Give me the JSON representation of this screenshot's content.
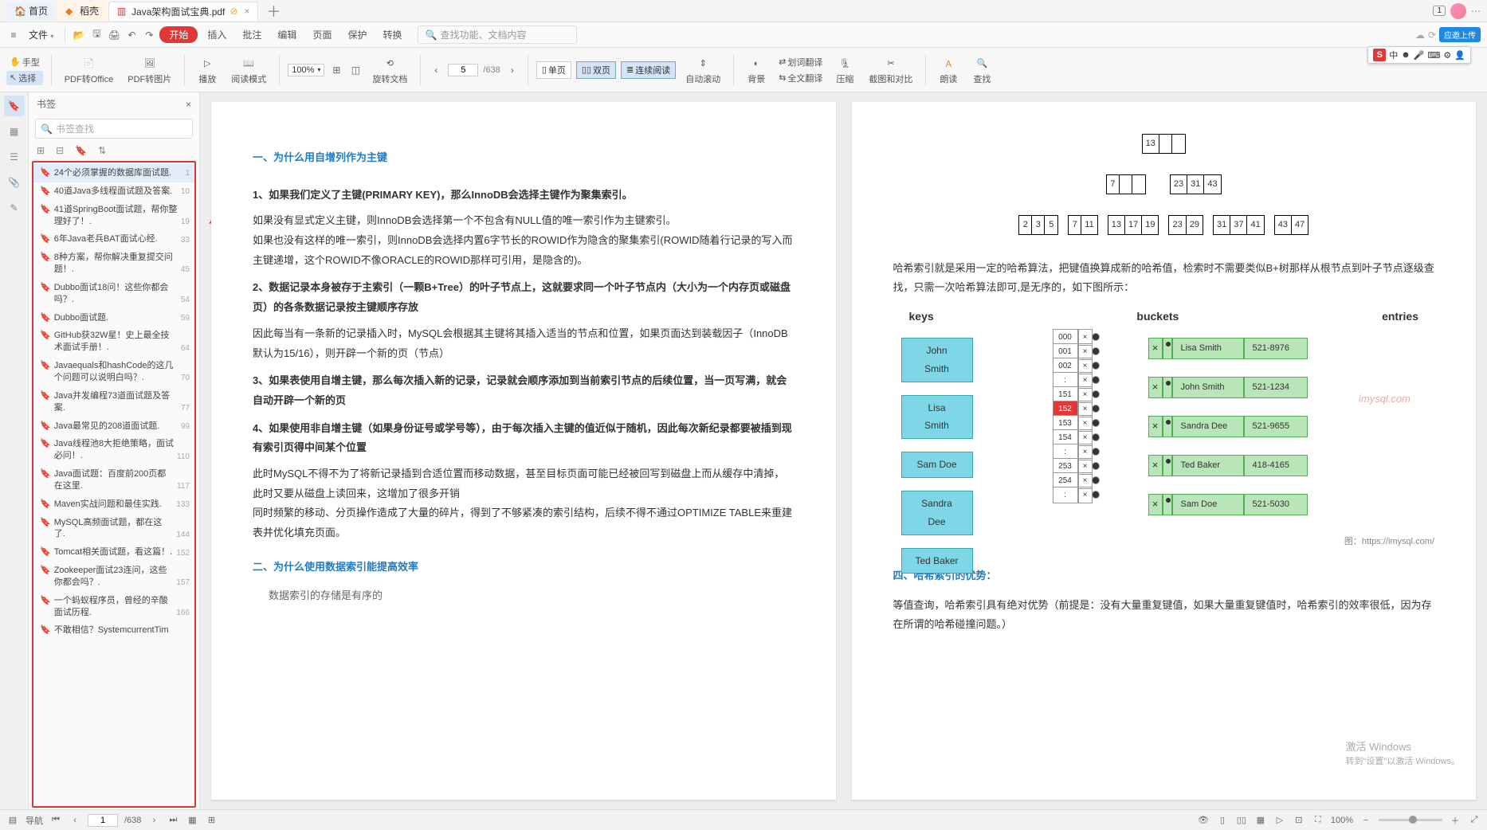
{
  "titlebar": {
    "home_tab": "首页",
    "doc_tab": "稻壳",
    "active_tab": "Java架构面试宝典.pdf",
    "badge": "1"
  },
  "menubar": {
    "file": "文件",
    "start": "开始",
    "items": [
      "插入",
      "批注",
      "编辑",
      "页面",
      "保护",
      "转换"
    ],
    "search_placeholder": "查找功能、文档内容",
    "upload": "应邀上传"
  },
  "toolbar": {
    "hand": "手型",
    "select": "选择",
    "pdf_office": "PDF转Office",
    "pdf_img": "PDF转图片",
    "play": "播放",
    "read_mode": "阅读模式",
    "zoom": "100%",
    "rotate": "旋转文档",
    "page_cur": "5",
    "page_total": "/638",
    "single": "单页",
    "double": "双页",
    "continuous": "连续阅读",
    "autoscroll": "自动滚动",
    "bg": "背景",
    "trans_sel": "划词翻译",
    "trans_full": "全文翻译",
    "compress": "压缩",
    "crop": "截图和对比",
    "tts": "朗读",
    "find": "查找"
  },
  "ime": {
    "label": "中"
  },
  "bookmarks": {
    "title": "书签",
    "search_placeholder": "书签查找",
    "items": [
      {
        "t": "24个必须掌握的数据库面试题.",
        "p": "1",
        "sel": true
      },
      {
        "t": "40道Java多线程面试题及答案.",
        "p": "10"
      },
      {
        "t": "41道SpringBoot面试题，帮你整理好了！.",
        "p": "19"
      },
      {
        "t": "6年Java老兵BAT面试心经.",
        "p": "33"
      },
      {
        "t": "8种方案，帮你解决重复提交问题！.",
        "p": "45"
      },
      {
        "t": "Dubbo面试18问！这些你都会吗？.",
        "p": "54"
      },
      {
        "t": "Dubbo面试题.",
        "p": "59"
      },
      {
        "t": "GitHub获32W星！史上最全技术面试手册！.",
        "p": "64"
      },
      {
        "t": "Javaequals和hashCode的这几个问题可以说明白吗？.",
        "p": "70"
      },
      {
        "t": "Java并发编程73道面试题及答案.",
        "p": "77"
      },
      {
        "t": "Java最常见的208道面试题.",
        "p": "99"
      },
      {
        "t": "Java线程池8大拒绝策略，面试必问！.",
        "p": "110"
      },
      {
        "t": "Java面试题：百度前200页都在这里.",
        "p": "117"
      },
      {
        "t": "Maven实战问题和最佳实践.",
        "p": "133"
      },
      {
        "t": "MySQL高频面试题，都在这了.",
        "p": "144"
      },
      {
        "t": "Tomcat相关面试题，看这篇！.",
        "p": "152"
      },
      {
        "t": "Zookeeper面试23连问，这些你都会吗？.",
        "p": "157"
      },
      {
        "t": "一个蚂蚁程序员，曾经的辛酸面试历程.",
        "p": "166"
      },
      {
        "t": "不敢相信？SystemcurrentTim",
        "p": ""
      }
    ]
  },
  "page_left": {
    "h1": "一、为什么用自增列作为主键",
    "p1": "1、如果我们定义了主键(PRIMARY KEY)，那么InnoDB会选择主键作为聚集索引。",
    "p2": "如果没有显式定义主键，则InnoDB会选择第一个不包含有NULL值的唯一索引作为主键索引。",
    "p3": "如果也没有这样的唯一索引，则InnoDB会选择内置6字节长的ROWID作为隐含的聚集索引(ROWID随着行记录的写入而主键递增，这个ROWID不像ORACLE的ROWID那样可引用，是隐含的)。",
    "p4": "2、数据记录本身被存于主索引（一颗B+Tree）的叶子节点上，这就要求同一个叶子节点内（大小为一个内存页或磁盘页）的各条数据记录按主键顺序存放",
    "p5": "因此每当有一条新的记录插入时，MySQL会根据其主键将其插入适当的节点和位置，如果页面达到装载因子（InnoDB默认为15/16），则开辟一个新的页（节点）",
    "p6": "3、如果表使用自增主键，那么每次插入新的记录，记录就会顺序添加到当前索引节点的后续位置，当一页写满，就会自动开辟一个新的页",
    "p7": "4、如果使用非自增主键（如果身份证号或学号等），由于每次插入主键的值近似于随机，因此每次新纪录都要被插到现有索引页得中间某个位置",
    "p8": "此时MySQL不得不为了将新记录插到合适位置而移动数据，甚至目标页面可能已经被回写到磁盘上而从缓存中清掉，此时又要从磁盘上读回来，这增加了很多开销",
    "p9": "同时频繁的移动、分页操作造成了大量的碎片，得到了不够紧凑的索引结构，后续不得不通过OPTIMIZE TABLE来重建表并优化填充页面。",
    "h2": "二、为什么使用数据索引能提高效率",
    "p10": "数据索引的存储是有序的"
  },
  "page_right": {
    "tree_root": "13",
    "tree_l": "7",
    "tree_r": [
      "23",
      "31",
      "43"
    ],
    "leaves": [
      [
        "2",
        "3",
        "5"
      ],
      [
        "7",
        "11"
      ],
      [
        "13",
        "17",
        "19"
      ],
      [
        "23",
        "29"
      ],
      [
        "31",
        "37",
        "41"
      ],
      [
        "43",
        "47"
      ]
    ],
    "hash_p1": "哈希索引就是采用一定的哈希算法，把键值换算成新的哈希值，检索时不需要类似B+树那样从根节点到叶子节点逐级查找，只需一次哈希算法即可,是无序的，如下图所示：",
    "cols": {
      "k": "keys",
      "b": "buckets",
      "e": "entries"
    },
    "keys": [
      "John Smith",
      "Lisa Smith",
      "Sam Doe",
      "Sandra Dee",
      "Ted Baker"
    ],
    "buckets": [
      "000",
      "001",
      "002",
      ":",
      "151",
      "152",
      "153",
      "154",
      ":",
      "253",
      "254",
      ":"
    ],
    "bucket_red_index": 5,
    "entries": [
      {
        "n": "Lisa Smith",
        "p": "521-8976"
      },
      {
        "n": "John Smith",
        "p": "521-1234"
      },
      {
        "n": "Sandra Dee",
        "p": "521-9655"
      },
      {
        "n": "Ted Baker",
        "p": "418-4165"
      },
      {
        "n": "Sam Doe",
        "p": "521-5030"
      }
    ],
    "watermark": "imysql.com",
    "fig_link": "图：https://imysql.com/",
    "h4": "四、哈希索引的优势：",
    "p4": "等值查询，哈希索引具有绝对优势（前提是：没有大量重复键值，如果大量重复键值时，哈希索引的效率很低，因为存在所谓的哈希碰撞问题。）"
  },
  "statusbar": {
    "nav": "导航",
    "page_cur": "1",
    "page_total": "/638",
    "zoom": "100%"
  },
  "win_activate": {
    "l1": "激活 Windows",
    "l2": "转到\"设置\"以激活 Windows。"
  }
}
